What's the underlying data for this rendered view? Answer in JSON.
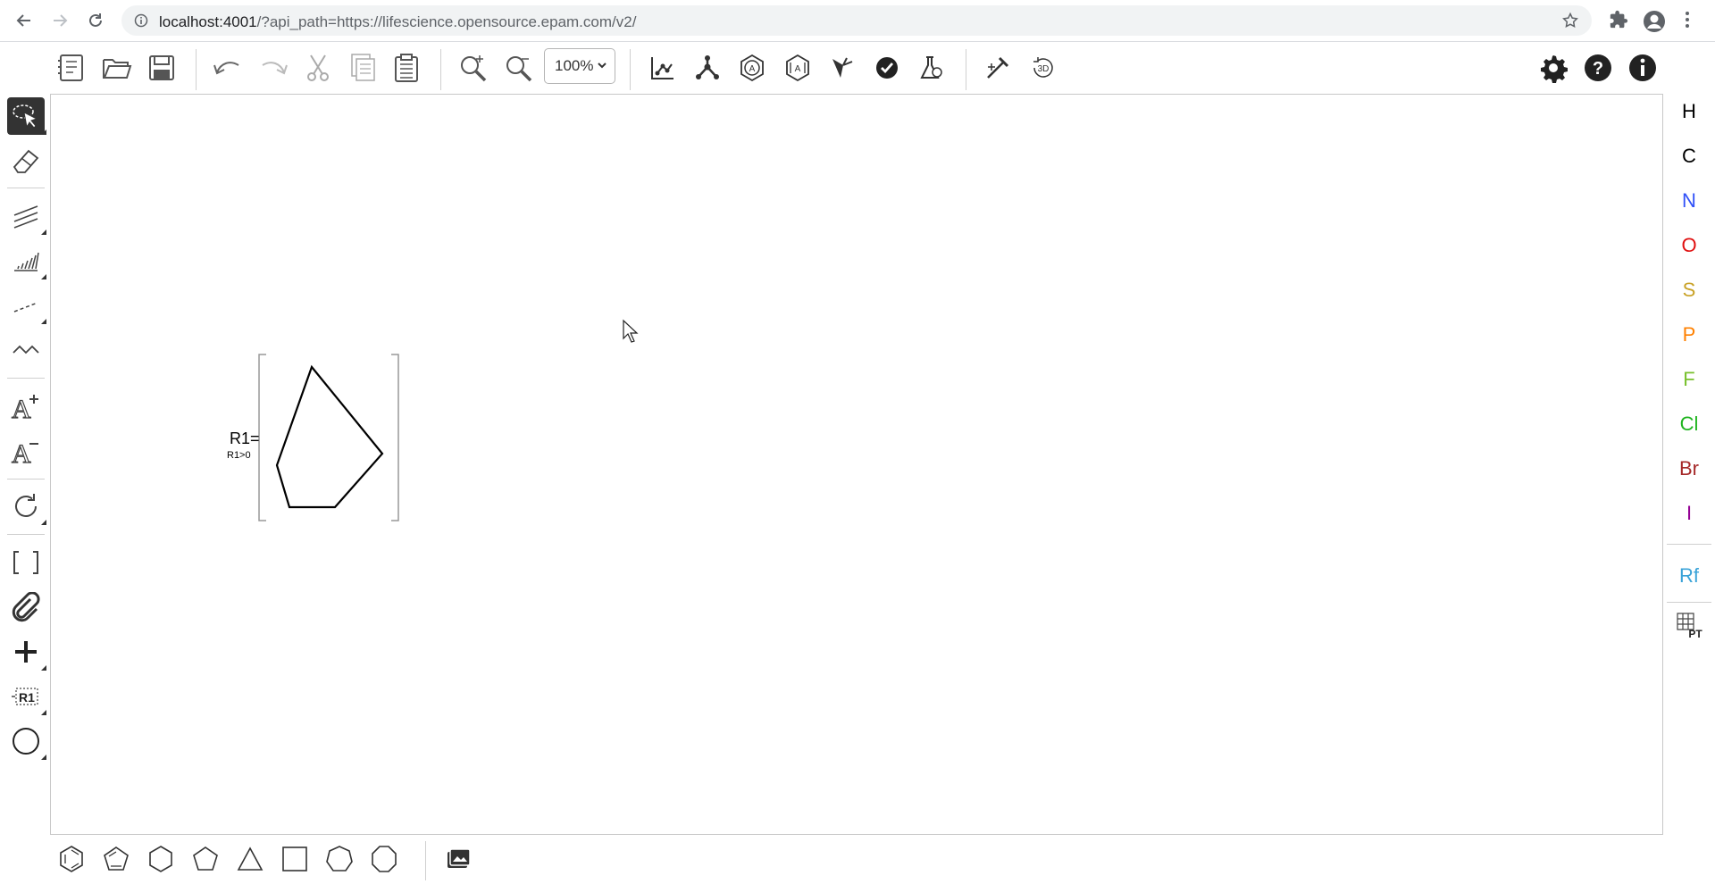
{
  "browser": {
    "url_host": "localhost:4001",
    "url_rest": "/?api_path=https://lifescience.opensource.epam.com/v2/"
  },
  "toolbar": {
    "zoom_value": "100%",
    "zoom_options": [
      "100%"
    ]
  },
  "elements": [
    {
      "symbol": "H",
      "color": "#000000"
    },
    {
      "symbol": "C",
      "color": "#000000"
    },
    {
      "symbol": "N",
      "color": "#3050f8"
    },
    {
      "symbol": "O",
      "color": "#e01010"
    },
    {
      "symbol": "S",
      "color": "#c9a227"
    },
    {
      "symbol": "P",
      "color": "#ff8000"
    },
    {
      "symbol": "F",
      "color": "#78c02c"
    },
    {
      "symbol": "Cl",
      "color": "#1fb41f"
    },
    {
      "symbol": "Br",
      "color": "#a62929"
    },
    {
      "symbol": "I",
      "color": "#940094"
    }
  ],
  "rgroup_button_label": "Rf",
  "periodic_table_label": "PT",
  "canvas": {
    "rgroup_label": "R1=",
    "rgroup_condition": "R1>0"
  },
  "left_toolbar": {
    "rgroup_tool_label": "R1"
  },
  "top_toolbar": {
    "3d_label": "3D"
  },
  "colors": {
    "active_tool_bg": "#333333",
    "canvas_border": "#c8c8c8"
  }
}
